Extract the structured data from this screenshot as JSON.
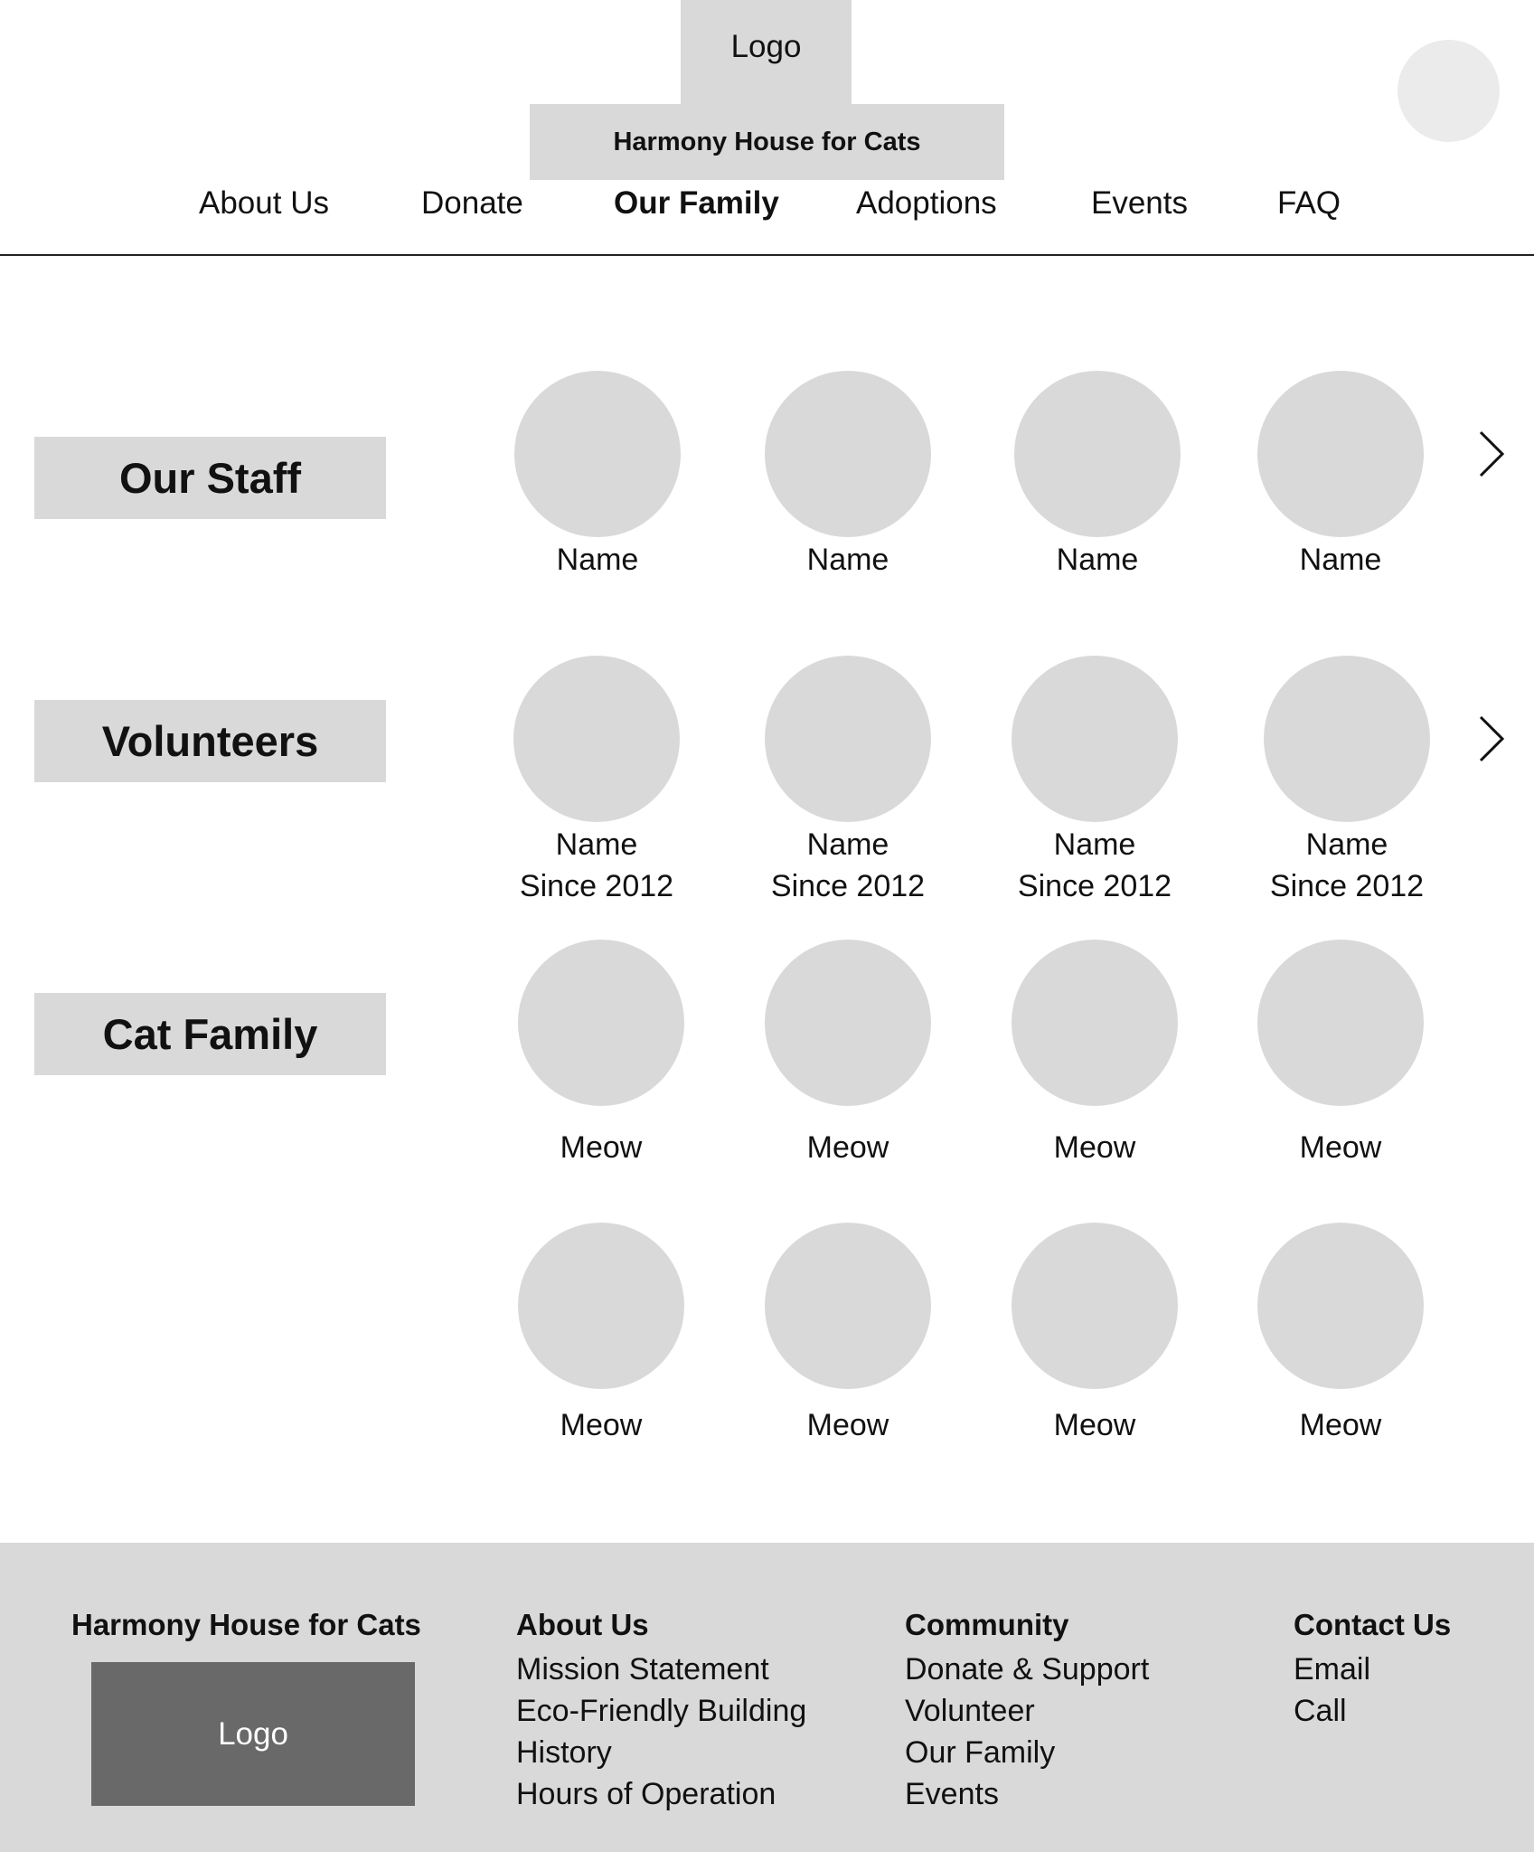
{
  "header": {
    "logo_label": "Logo",
    "site_title": "Harmony House for Cats"
  },
  "nav": {
    "items": [
      "About Us",
      "Donate",
      "Our Family",
      "Adoptions",
      "Events",
      "FAQ"
    ],
    "active": "Our Family"
  },
  "sections": {
    "staff": {
      "title": "Our Staff",
      "members": [
        {
          "name": "Name"
        },
        {
          "name": "Name"
        },
        {
          "name": "Name"
        },
        {
          "name": "Name"
        }
      ]
    },
    "volunteers": {
      "title": "Volunteers",
      "members": [
        {
          "name": "Name",
          "since": "Since 2012"
        },
        {
          "name": "Name",
          "since": "Since 2012"
        },
        {
          "name": "Name",
          "since": "Since 2012"
        },
        {
          "name": "Name",
          "since": "Since 2012"
        }
      ]
    },
    "cats": {
      "title": "Cat Family",
      "members": [
        {
          "name": "Meow"
        },
        {
          "name": "Meow"
        },
        {
          "name": "Meow"
        },
        {
          "name": "Meow"
        },
        {
          "name": "Meow"
        },
        {
          "name": "Meow"
        },
        {
          "name": "Meow"
        },
        {
          "name": "Meow"
        }
      ]
    }
  },
  "footer": {
    "brand": "Harmony House for Cats",
    "logo_label": "Logo",
    "columns": [
      {
        "heading": "About Us",
        "links": [
          "Mission Statement",
          "Eco-Friendly Building",
          "History",
          "Hours of Operation"
        ]
      },
      {
        "heading": "Community",
        "links": [
          "Donate & Support",
          "Volunteer",
          "Our Family",
          "Events"
        ]
      },
      {
        "heading": "Contact Us",
        "links": [
          "Email",
          "Call"
        ]
      }
    ]
  },
  "colors": {
    "placeholder": "#d9d9d9",
    "footer_logo": "#696969",
    "avatar": "#ebebeb"
  }
}
